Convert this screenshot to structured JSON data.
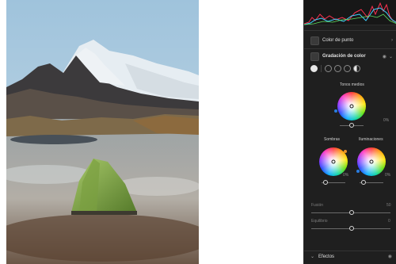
{
  "panel": {
    "color_de_punto": {
      "label": "Color de punto",
      "icon": "color-picker-icon"
    },
    "gradacion": {
      "label": "Gradación de color",
      "icon": "color-grading-icon"
    },
    "modes": [
      "three-wheels-mode-icon",
      "shadows-mode-icon",
      "midtones-mode-icon",
      "highlights-mode-icon",
      "global-mode-icon"
    ],
    "tonos_medios": {
      "label": "Tonos medios",
      "value": "0%",
      "slider": 0.5
    },
    "sombras": {
      "label": "Sombras",
      "value": "0%",
      "slider": 0.2
    },
    "iluminaciones": {
      "label": "Iluminaciones",
      "value": "0%",
      "slider": 0.2
    },
    "fusion": {
      "label": "Fusión",
      "value": "50",
      "slider": 0.5
    },
    "equilibrio": {
      "label": "Equilibrio",
      "value": "0",
      "slider": 0.5
    },
    "efectos": {
      "label": "Efectos"
    }
  },
  "colors": {
    "panel_bg": "#1f1f1f",
    "shadow_marker": "#2a7de1",
    "shadow_marker_2": "#e8902a",
    "highlight_marker": "#2a7de1",
    "midtone_marker": "#2a7de1"
  }
}
